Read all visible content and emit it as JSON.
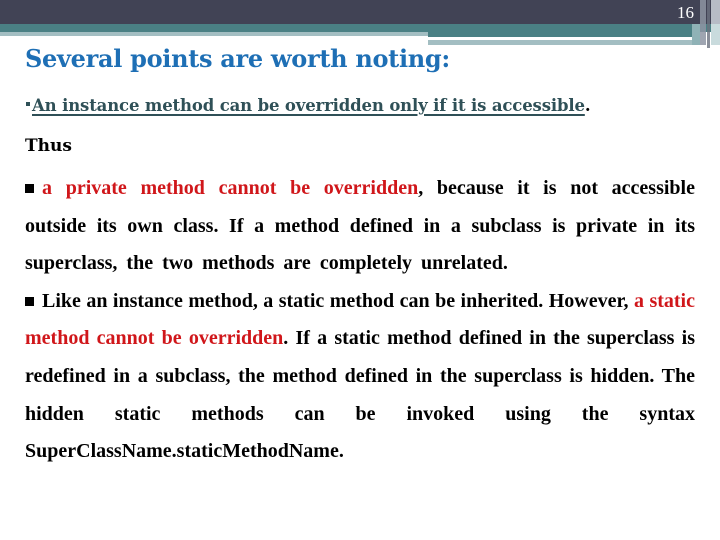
{
  "slide": {
    "page_number": "16",
    "title": "Several points are worth noting:",
    "intro": {
      "bullet_icon": "small-square-bullet",
      "text": "An instance method can be overridden only if it is accessible",
      "period": "."
    },
    "thus": "Thus",
    "points": [
      {
        "bullet_icon": "square-bullet",
        "red_text": "a private method cannot be overridden",
        "after_red": ", because it is not accessible outside its own class. If a method defined in a subclass is private in its superclass, the two methods are",
        "last_line": "completely unrelated."
      },
      {
        "bullet_icon": "square-bullet",
        "before_red": "Like an instance method, a static method can be inherited. However, ",
        "red_text": "a static method cannot be overridden",
        "after_red": ". If a static method defined in the superclass is redefined in a subclass, the method defined in the superclass is hidden. The hidden static methods can be invoked using the syntax",
        "last_line": "SuperClassName.staticMethodName."
      }
    ]
  },
  "colors": {
    "header_dark": "#414355",
    "header_teal": "#4A8084",
    "header_light": "#A3BEC2",
    "title_blue": "#1E6FB5",
    "intro_teal_dark": "#2F5057",
    "highlight_red": "#D0161A"
  }
}
